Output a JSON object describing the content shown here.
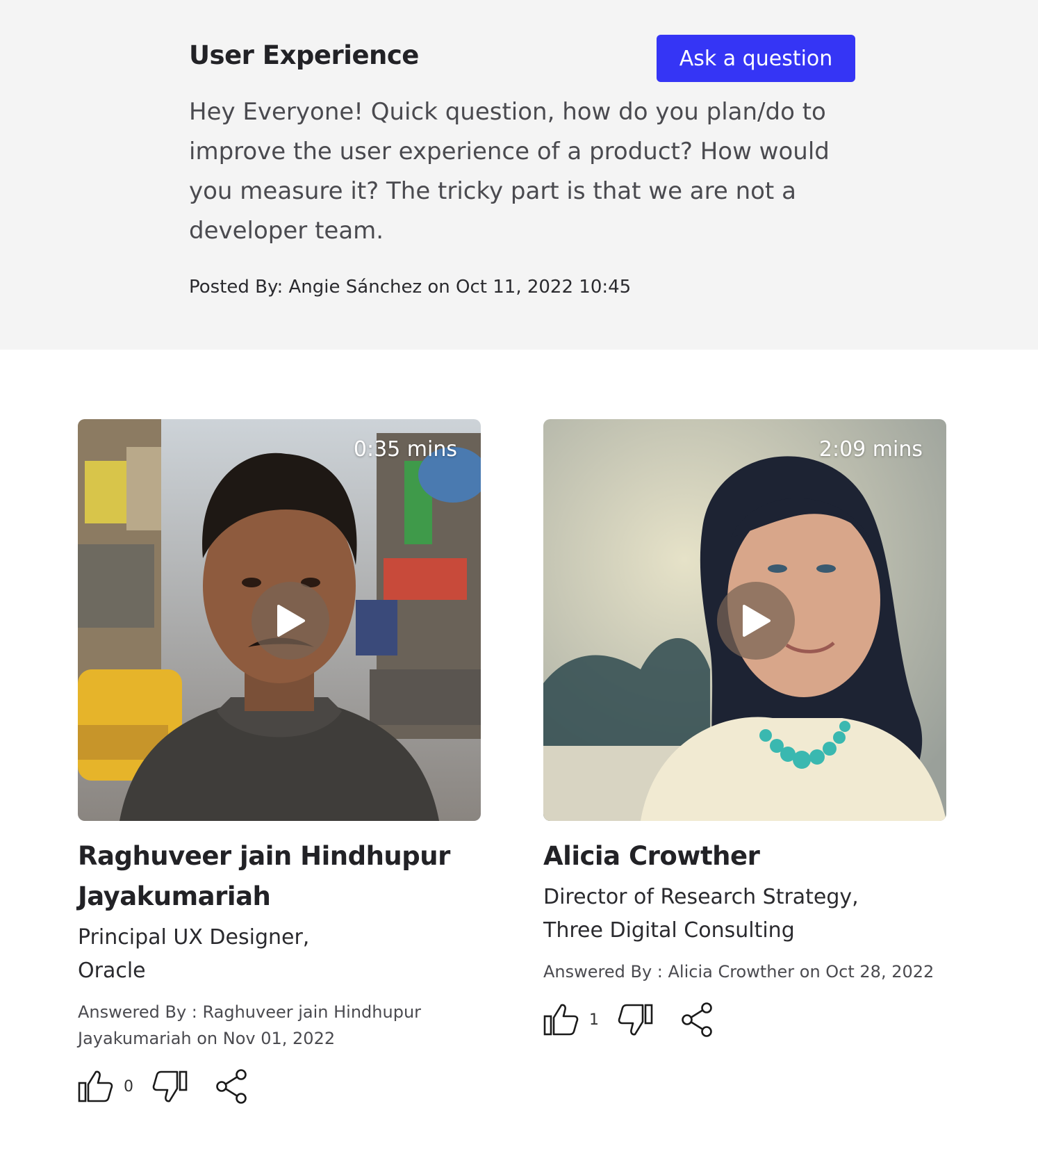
{
  "question": {
    "title": "User Experience",
    "ask_button_label": "Ask a question",
    "body": "Hey Everyone! Quick question, how do you plan/do to improve the user experience of a product? How would you measure it? The tricky part is that we are not a developer team.",
    "posted_by": "Posted By: Angie Sánchez on Oct 11, 2022 10:45"
  },
  "answers": [
    {
      "duration": "0:35 mins",
      "name": "Raghuveer jain Hindhupur Jayakumariah",
      "role_line1": "Principal UX Designer,",
      "role_line2": "Oracle",
      "answered_by": "Answered By : Raghuveer jain Hindhupur Jayakumariah on Nov 01, 2022",
      "likes": "0"
    },
    {
      "duration": "2:09 mins",
      "name": "Alicia Crowther",
      "role_line1": "Director of Research Strategy,",
      "role_line2": "Three Digital Consulting",
      "answered_by": "Answered By : Alicia Crowther on Oct 28, 2022",
      "likes": "1"
    }
  ],
  "colors": {
    "accent": "#3535f5",
    "panel_background": "#f4f4f4"
  },
  "icons": [
    "play-icon",
    "thumbs-up-icon",
    "thumbs-down-icon",
    "share-icon"
  ]
}
